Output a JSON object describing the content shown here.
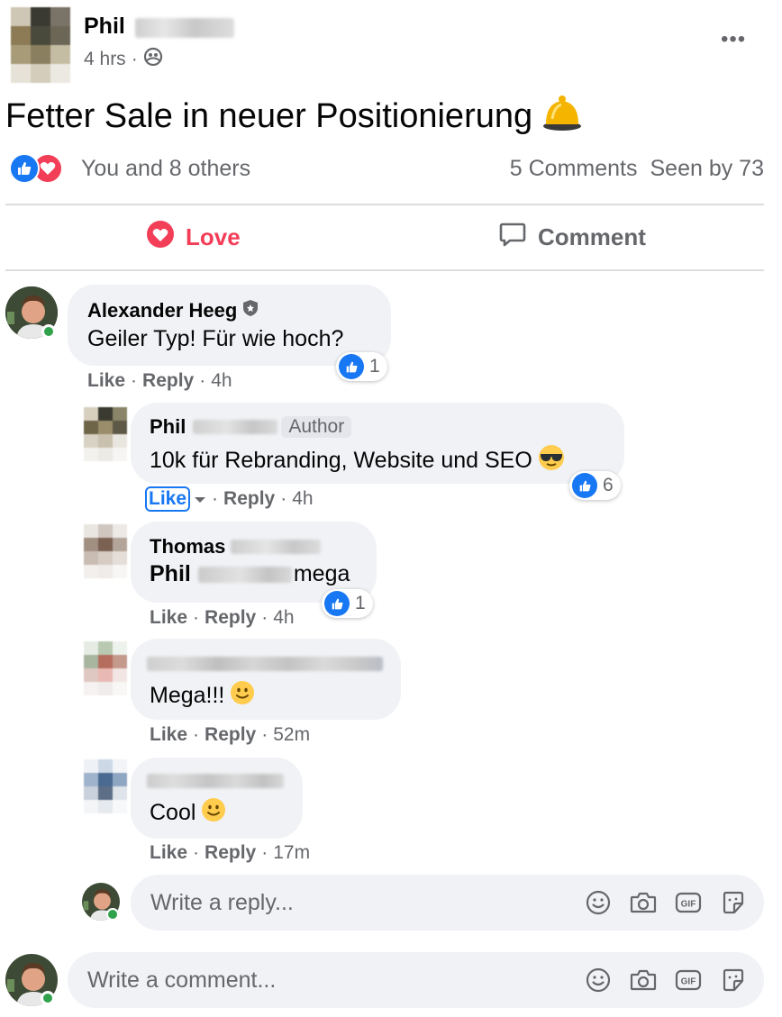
{
  "post": {
    "author_first": "Phil",
    "time": "4 hrs",
    "audience_icon": "friends-icon",
    "more_label": "•••",
    "text": "Fetter Sale in neuer Positionierung",
    "emoji": "🛎️"
  },
  "reactions": {
    "summary": "You and 8 others",
    "comments": "5 Comments",
    "seen": "Seen by 73"
  },
  "actions": {
    "love": "Love",
    "comment": "Comment"
  },
  "comments": [
    {
      "name": "Alexander Heeg",
      "text": "Geiler Typ! Für wie hoch?",
      "like": "Like",
      "reply": "Reply",
      "time": "4h",
      "reaction_count": "1"
    },
    {
      "name": "Phil",
      "badge": "Author",
      "text": "10k für Rebranding, Website und SEO",
      "emoji": "😎",
      "like": "Like",
      "reply": "Reply",
      "time": "4h",
      "reaction_count": "6"
    },
    {
      "name": "Thomas",
      "mention": "Phil",
      "text": "mega",
      "like": "Like",
      "reply": "Reply",
      "time": "4h",
      "reaction_count": "1"
    },
    {
      "text": "Mega!!!",
      "emoji": "🙂",
      "like": "Like",
      "reply": "Reply",
      "time": "52m"
    },
    {
      "text": "Cool",
      "emoji": "🙂",
      "like": "Like",
      "reply": "Reply",
      "time": "17m"
    }
  ],
  "reply_input": {
    "placeholder": "Write a reply..."
  },
  "comment_input": {
    "placeholder": "Write a comment..."
  },
  "input_icons": [
    "emoji-icon",
    "camera-icon",
    "gif-icon",
    "sticker-icon"
  ],
  "colors": {
    "love": "#f33e58",
    "like": "#1877f2",
    "muted": "#65676b",
    "bubble": "#f0f2f5"
  }
}
